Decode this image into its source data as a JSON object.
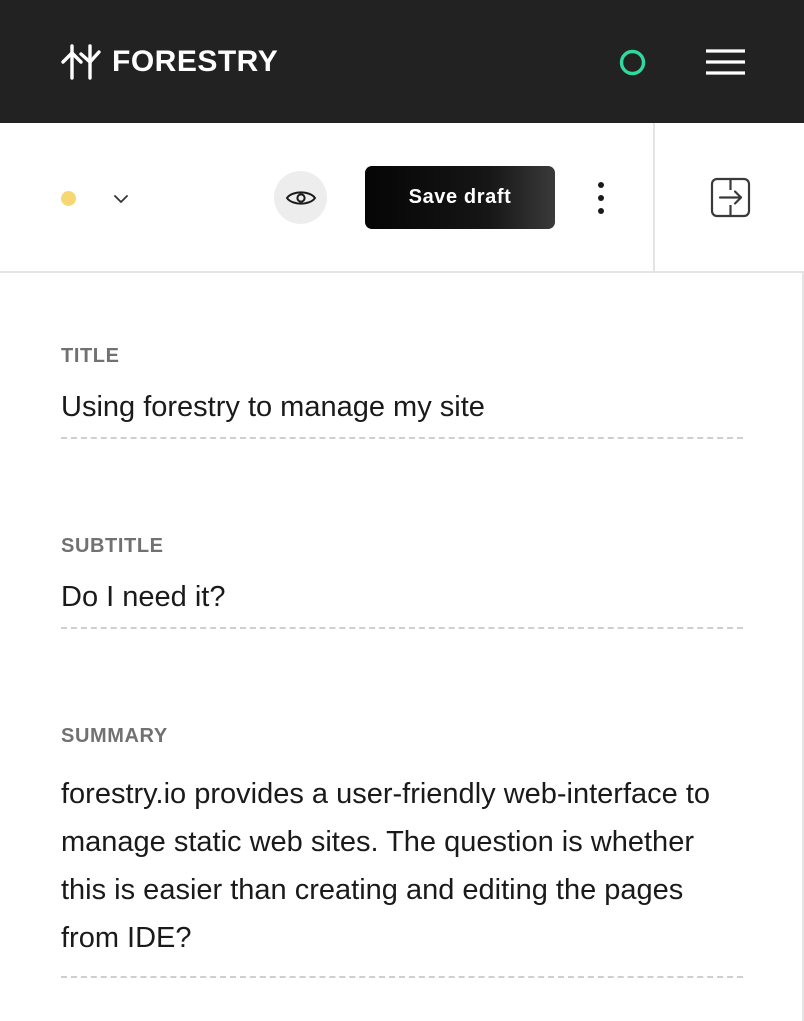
{
  "header": {
    "brand": "FORESTRY",
    "logo_icon": "forestry-tree-logo-icon",
    "status_icon": "sync-status-ring-icon",
    "status_color": "#2ddc9c",
    "menu_icon": "hamburger-menu-icon"
  },
  "toolbar": {
    "status_dot_color": "#f7d774",
    "status_dropdown_icon": "chevron-down-icon",
    "preview_icon": "eye-icon",
    "save_label": "Save draft",
    "more_icon": "more-vertical-icon",
    "split_icon": "split-view-arrow-icon"
  },
  "form": {
    "title": {
      "label": "TITLE",
      "value": "Using forestry to manage my site"
    },
    "subtitle": {
      "label": "SUBTITLE",
      "value": "Do I need it?"
    },
    "summary": {
      "label": "SUMMARY",
      "value": "forestry.io provides a user-friendly web-interface to manage static web sites. The question is whether this is easier than creating and editing the pages from IDE?"
    }
  }
}
